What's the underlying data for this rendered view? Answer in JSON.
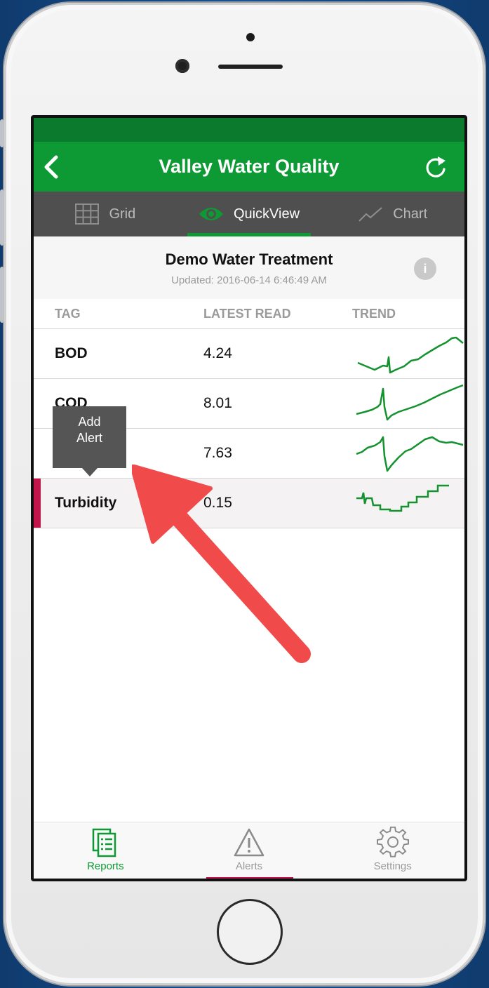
{
  "navbar": {
    "title": "Valley Water Quality"
  },
  "tabs": [
    {
      "label": "Grid",
      "icon": "grid-icon"
    },
    {
      "label": "QuickView",
      "icon": "eye-icon",
      "active": true
    },
    {
      "label": "Chart",
      "icon": "chart-line-icon"
    }
  ],
  "header": {
    "title": "Demo Water Treatment",
    "updated": "Updated: 2016-06-14 6:46:49 AM",
    "info_label": "i"
  },
  "columns": {
    "tag": "TAG",
    "latest": "LATEST READ",
    "trend": "TREND"
  },
  "rows": [
    {
      "tag": "BOD",
      "value": "4.24"
    },
    {
      "tag": "COD",
      "value": "8.01"
    },
    {
      "tag": "",
      "value": "7.63"
    },
    {
      "tag": "Turbidity",
      "value": "0.15",
      "highlighted": true
    }
  ],
  "tooltip": {
    "line1": "Add",
    "line2": "Alert"
  },
  "tabbar": [
    {
      "label": "Reports",
      "icon": "reports-icon",
      "active": true
    },
    {
      "label": "Alerts",
      "icon": "alert-triangle-icon"
    },
    {
      "label": "Settings",
      "icon": "gear-icon"
    }
  ],
  "colors": {
    "primary": "#0d9a35",
    "status_bar": "#0b7a2c",
    "tab_bg": "#4f4f4f",
    "highlight": "#c1154b",
    "arrow": "#f14a4a",
    "trend": "#13922f"
  }
}
